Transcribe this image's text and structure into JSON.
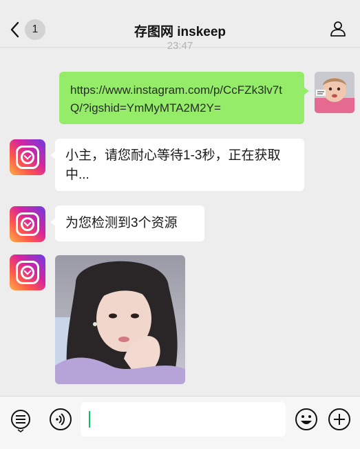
{
  "header": {
    "title": "存图网 inskeep",
    "unread_count": "1",
    "back_icon": "chevron-left-icon",
    "profile_icon": "person-icon"
  },
  "chat": {
    "timestamp": "23:47",
    "messages": [
      {
        "from": "me",
        "type": "text",
        "text": "https://www.instagram.com/p/CcFZk3lv7tQ/?igshid=YmMyMTA2M2Y="
      },
      {
        "from": "bot",
        "type": "text",
        "text": "小主，请您耐心等待1-3秒，正在获取中..."
      },
      {
        "from": "bot",
        "type": "text",
        "text": "为您检测到3个资源"
      },
      {
        "from": "bot",
        "type": "image"
      }
    ]
  },
  "input_bar": {
    "voice_icon": "voice-icon",
    "emoji_icon": "emoji-icon",
    "plus_icon": "plus-icon",
    "menu_icon": "menu-list-icon",
    "text_value": ""
  },
  "colors": {
    "background": "#ededed",
    "outgoing_bubble": "#95ec69",
    "incoming_bubble": "#ffffff",
    "caret": "#07c160"
  }
}
